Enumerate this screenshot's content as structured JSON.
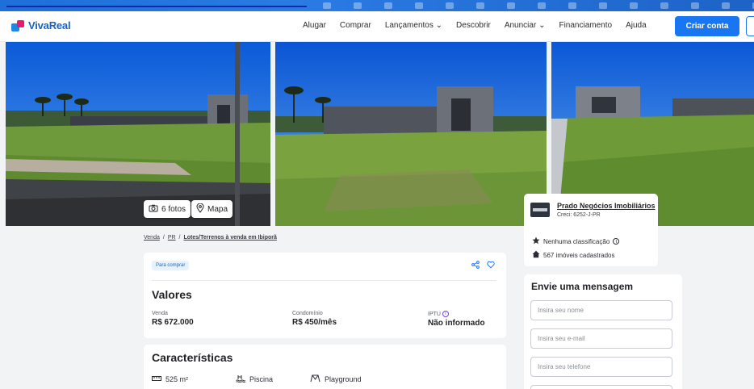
{
  "nav": {
    "logo": "VivaReal",
    "items": [
      "Alugar",
      "Comprar",
      "Lançamentos",
      "Descobrir",
      "Anunciar",
      "Financiamento",
      "Ajuda"
    ],
    "create_account": "Criar conta"
  },
  "gallery": {
    "photos_button": "6 fotos",
    "map_button": "Mapa"
  },
  "breadcrumb": [
    "Venda",
    "PR",
    "Lotes/Terrenos à venda em Ibiporã"
  ],
  "listing": {
    "tag": "Para comprar",
    "values_title": "Valores",
    "sale_label": "Venda",
    "sale_value": "R$ 672.000",
    "condo_label": "Condomínio",
    "condo_value": "R$ 450/mês",
    "iptu_label": "IPTU",
    "iptu_value": "Não informado",
    "features_title": "Características",
    "features": [
      "525 m²",
      "Piscina",
      "Playground"
    ]
  },
  "agency": {
    "name": "Prado Negócios Imobiliários",
    "creci": "Creci: 6252-J-PR",
    "rating": "Nenhuma classificação",
    "listings": "567 imóveis cadastrados"
  },
  "message": {
    "title": "Envie uma mensagem",
    "name_placeholder": "Insira seu nome",
    "email_placeholder": "Insira seu e-mail",
    "phone_placeholder": "Insira seu telefone"
  },
  "colors": {
    "brand_blue": "#1976f2",
    "accent_pink": "#e8196f"
  }
}
